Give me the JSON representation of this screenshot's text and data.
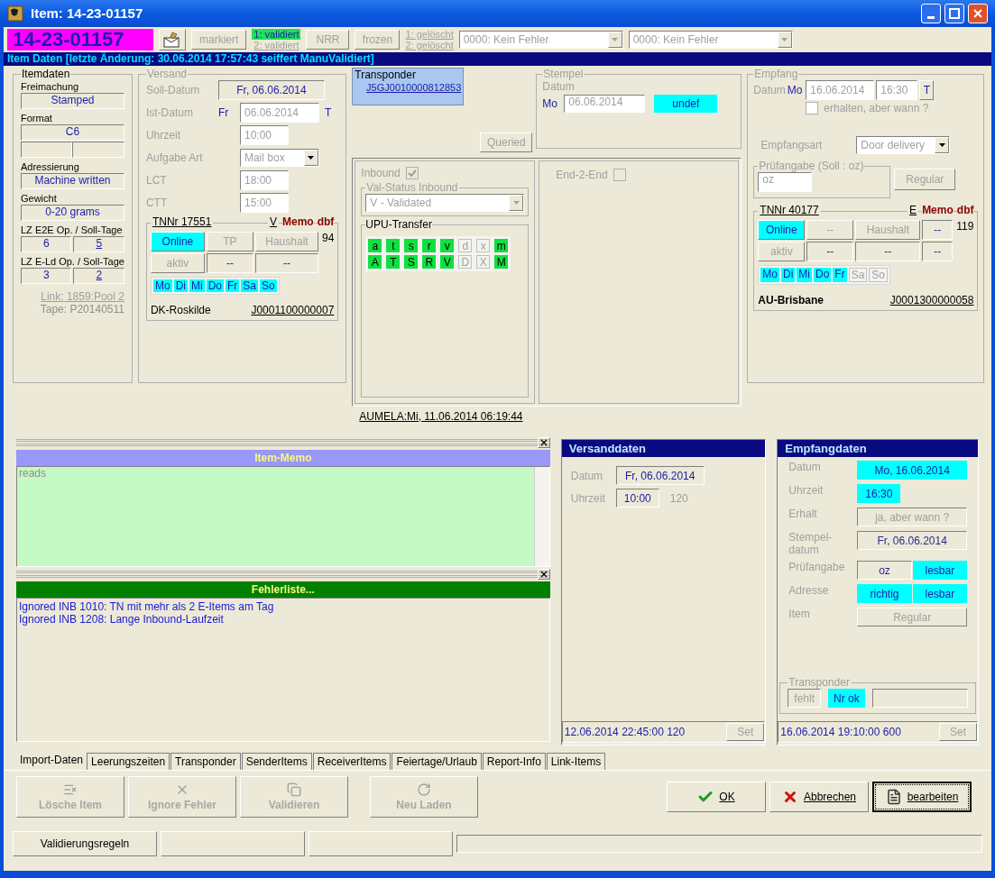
{
  "window": {
    "title": "Item: 14-23-01157"
  },
  "toolbar": {
    "item_number": "14-23-01157",
    "marked": "markiert",
    "validation": [
      {
        "label": "1: validiert",
        "on": true
      },
      {
        "label": "2: validiert",
        "on": false
      }
    ],
    "nrr": "NRR",
    "frozen": "frozen",
    "deleted": [
      "1: gelöscht",
      "2: gelöscht"
    ],
    "error_selects": [
      "0000: Kein Fehler",
      "0000: Kein Fehler"
    ]
  },
  "header": "Item Daten [letzte Änderung: 30.06.2014 17:57:43 seiffert ManuValidiert]",
  "itemdaten": {
    "title": "Itemdaten",
    "fields": [
      {
        "label": "Freimachung",
        "kind": "single",
        "values": [
          "Stamped"
        ]
      },
      {
        "label": "Format",
        "kind": "single_blank",
        "values": [
          "C6"
        ]
      },
      {
        "label": "Adressierung",
        "kind": "single",
        "values": [
          "Machine written"
        ]
      },
      {
        "label": "Gewicht",
        "kind": "single",
        "values": [
          "0-20 grams"
        ]
      },
      {
        "label": "LZ E2E Op. / Soll-Tage",
        "kind": "pair",
        "values": [
          "6",
          "5"
        ]
      },
      {
        "label": "LZ E-Ld Op. / Soll-Tage",
        "kind": "pair",
        "values": [
          "3",
          "2"
        ]
      }
    ],
    "link": "Link: 1859:Pool 2",
    "tape": "Tape: P20140511"
  },
  "versand": {
    "title": "Versand",
    "rows": [
      {
        "label": "Soll-Datum",
        "kind": "display",
        "value": "Fr, 06.06.2014"
      },
      {
        "label": "Ist-Datum",
        "kind": "date_input",
        "prefix": "Fr",
        "value": "06.06.2014",
        "suffix": "T"
      },
      {
        "label": "Uhrzeit",
        "kind": "time_input",
        "value": "10:00"
      },
      {
        "label": "Aufgabe Art",
        "kind": "select",
        "value": "Mail box"
      },
      {
        "label": "LCT",
        "kind": "time_input",
        "value": "18:00"
      },
      {
        "label": "CTT",
        "kind": "time_input",
        "value": "15:00"
      }
    ]
  },
  "sender_tn": {
    "title": "TNNr 17551",
    "flag": "V",
    "memo": "Memo",
    "dbf": "dbf",
    "count": "94",
    "rows": [
      [
        {
          "text": "Online",
          "kind": "button",
          "highlighted": true
        },
        {
          "text": "TP",
          "kind": "button",
          "highlighted": false
        },
        {
          "text": "Haushalt",
          "kind": "button",
          "highlighted": false
        }
      ],
      [
        {
          "text": "aktiv",
          "kind": "button",
          "highlighted": false
        },
        {
          "text": "--",
          "kind": "field",
          "highlighted": false
        },
        {
          "text": "--",
          "kind": "field",
          "highlighted": false
        }
      ]
    ],
    "days": [
      {
        "label": "Mo",
        "on": true
      },
      {
        "label": "Di",
        "on": true
      },
      {
        "label": "Mi",
        "on": true
      },
      {
        "label": "Do",
        "on": true
      },
      {
        "label": "Fr",
        "on": true
      },
      {
        "label": "Sa",
        "on": true
      },
      {
        "label": "So",
        "on": true
      }
    ],
    "city": "DK-Roskilde",
    "code": "J0001100000007"
  },
  "transponder": {
    "title": "Transponder",
    "number": "J5GJ0010000812853",
    "status": "Queried"
  },
  "inbound": {
    "label": "Inbound",
    "checked": true,
    "val_status_title": "Val-Status Inbound",
    "val_status": "V - Validated"
  },
  "upu": {
    "title": "UPU-Transfer",
    "rows": [
      [
        {
          "letter": "a",
          "on": true
        },
        {
          "letter": "t",
          "on": true
        },
        {
          "letter": "s",
          "on": true
        },
        {
          "letter": "r",
          "on": true
        },
        {
          "letter": "v",
          "on": true
        },
        {
          "letter": "d",
          "on": false
        },
        {
          "letter": "x",
          "on": false
        },
        {
          "letter": "m",
          "on": true
        }
      ],
      [
        {
          "letter": "A",
          "on": true
        },
        {
          "letter": "T",
          "on": true
        },
        {
          "letter": "S",
          "on": true
        },
        {
          "letter": "R",
          "on": true
        },
        {
          "letter": "V",
          "on": true
        },
        {
          "letter": "D",
          "on": false
        },
        {
          "letter": "X",
          "on": false
        },
        {
          "letter": "M",
          "on": true
        }
      ]
    ]
  },
  "aumela": "AUMELA:Mi, 11.06.2014 06:19:44",
  "stempel": {
    "title": "Stempel",
    "date_label": "Datum",
    "weekday": "Mo",
    "date": "06.06.2014",
    "status": "undef"
  },
  "end2end": {
    "label": "End-2-End",
    "checked": false
  },
  "empfang": {
    "title": "Empfang",
    "date_label": "Datum",
    "weekday": "Mo",
    "date": "16.06.2014",
    "time": "16:30",
    "t_button": "T",
    "received": {
      "label": "erhalten, aber wann ?",
      "checked": false
    },
    "type_label": "Empfangsart",
    "type": "Door delivery",
    "check_title": "Prüfangabe (Soll : oz)",
    "check_value": "oz",
    "regular": "Regular"
  },
  "receiver_tn": {
    "title": "TNNr 40177",
    "flag": "E",
    "memo": "Memo",
    "dbf": "dbf",
    "count": "119",
    "rows": [
      [
        {
          "text": "Online",
          "kind": "button",
          "highlighted": true
        },
        {
          "text": "--",
          "kind": "button",
          "highlighted": false
        },
        {
          "text": "Haushalt",
          "kind": "button",
          "highlighted": false
        },
        {
          "text": "--",
          "kind": "field",
          "highlighted": false
        }
      ],
      [
        {
          "text": "aktiv",
          "kind": "button",
          "highlighted": false
        },
        {
          "text": "--",
          "kind": "field",
          "highlighted": false
        },
        {
          "text": "--",
          "kind": "field",
          "highlighted": false
        },
        {
          "text": "--",
          "kind": "field",
          "highlighted": false
        }
      ]
    ],
    "days": [
      {
        "label": "Mo",
        "on": true
      },
      {
        "label": "Di",
        "on": true
      },
      {
        "label": "Mi",
        "on": true
      },
      {
        "label": "Do",
        "on": true
      },
      {
        "label": "Fr",
        "on": true
      },
      {
        "label": "Sa",
        "on": false
      },
      {
        "label": "So",
        "on": false
      }
    ],
    "city": "AU-Brisbane",
    "code": "J0001300000058"
  },
  "memo": {
    "title": "Item-Memo",
    "text": "reads"
  },
  "errors": {
    "title": "Fehlerliste...",
    "lines": [
      "Ignored INB 1010: TN mit mehr als 2 E-Items am Tag",
      "Ignored INB 1208: Lange Inbound-Laufzeit"
    ]
  },
  "versanddaten": {
    "title": "Versanddaten",
    "date_label": "Datum",
    "date": "Fr, 06.06.2014",
    "time_label": "Uhrzeit",
    "time": "10:00",
    "duration": "120",
    "footer": "12.06.2014 22:45:00 120",
    "set": "Set"
  },
  "empfangdaten": {
    "title": "Empfangdaten",
    "rows": [
      {
        "label": "Datum",
        "cells": [
          {
            "text": "Mo, 16.06.2014",
            "kind": "field",
            "highlighted": true
          }
        ]
      },
      {
        "label": "Uhrzeit",
        "cells": [
          {
            "text": "16:30",
            "kind": "short",
            "highlighted": true
          }
        ]
      },
      {
        "label": "Erhalt",
        "cells": [
          {
            "text": "ja, aber wann ?",
            "kind": "field",
            "highlighted": false
          }
        ]
      },
      {
        "label": "Stempel-datum",
        "cells": [
          {
            "text": "Fr, 06.06.2014",
            "kind": "field",
            "highlighted": false
          }
        ]
      },
      {
        "label": "Prüfangabe",
        "cells": [
          {
            "text": "oz",
            "kind": "field",
            "highlighted": false
          },
          {
            "text": "lesbar",
            "kind": "field",
            "highlighted": true
          }
        ]
      },
      {
        "label": "Adresse",
        "cells": [
          {
            "text": "richtig",
            "kind": "field",
            "highlighted": true
          },
          {
            "text": "lesbar",
            "kind": "field",
            "highlighted": true
          }
        ]
      },
      {
        "label": "Item",
        "cells": [
          {
            "text": "Regular",
            "kind": "button"
          }
        ]
      }
    ],
    "transponder": {
      "title": "Transponder",
      "cells": [
        {
          "text": "fehlt",
          "highlighted": false
        },
        {
          "text": "Nr ok",
          "highlighted": true
        }
      ]
    },
    "footer": "16.06.2014 19:10:00 600",
    "set": "Set"
  },
  "tabs": [
    {
      "label": "Import-Daten",
      "selected": true
    },
    {
      "label": "Leerungszeiten",
      "selected": false
    },
    {
      "label": "Transponder",
      "selected": false
    },
    {
      "label": "SenderItems",
      "selected": false
    },
    {
      "label": "ReceiverItems",
      "selected": false
    },
    {
      "label": "Feiertage/Urlaub",
      "selected": false
    },
    {
      "label": "Report-Info",
      "selected": false
    },
    {
      "label": "Link-Items",
      "selected": false
    }
  ],
  "actions": [
    {
      "label": "Lösche Item",
      "disabled": true
    },
    {
      "label": "Ignore Fehler",
      "disabled": true
    },
    {
      "label": "Validieren",
      "disabled": true
    },
    {
      "label": "Neu Laden",
      "disabled": true
    }
  ],
  "dialog_buttons": [
    {
      "label": "OK",
      "focused": false
    },
    {
      "label": "Abbrechen",
      "focused": false
    },
    {
      "label": "bearbeiten",
      "focused": true
    }
  ],
  "status_bar": {
    "button": "Validierungsregeln"
  }
}
